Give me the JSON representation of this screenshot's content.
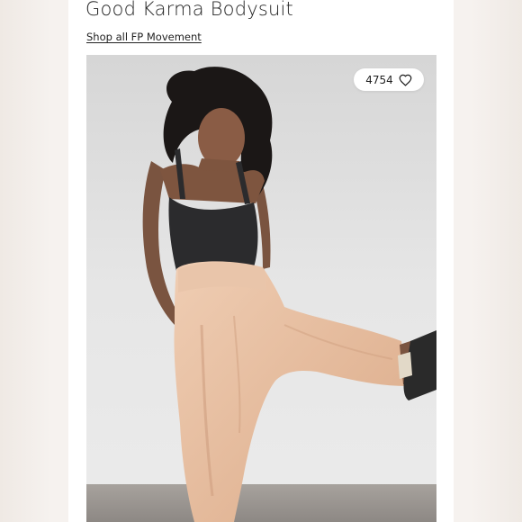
{
  "product": {
    "title": "Good Karma Bodysuit",
    "shop_link_label": "Shop all FP Movement"
  },
  "image": {
    "icon": "product-photo",
    "description_alt": "Model wearing black bodysuit and blush harem pants"
  },
  "like": {
    "count": "4754",
    "icon": "heart-icon"
  },
  "colors": {
    "panel": "#ffffff",
    "backdrop": "#f2eeea",
    "text": "#222222",
    "pants": "#e6c0a4",
    "bodysuit": "#2b2b2d"
  }
}
